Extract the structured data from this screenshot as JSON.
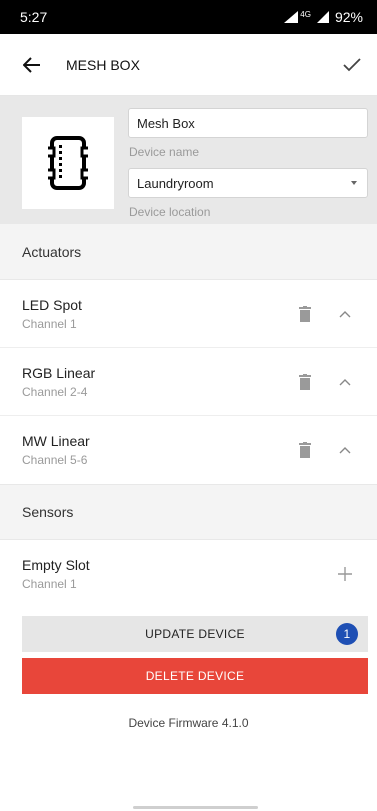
{
  "status_bar": {
    "time": "5:27",
    "network": "4G",
    "battery": "92%"
  },
  "app_bar": {
    "title": "MESH BOX"
  },
  "device": {
    "name_value": "Mesh Box",
    "name_label": "Device name",
    "location_value": "Laundryroom",
    "location_label": "Device location"
  },
  "actuators": {
    "header": "Actuators",
    "items": [
      {
        "name": "LED Spot",
        "channel": "Channel 1"
      },
      {
        "name": "RGB Linear",
        "channel": "Channel 2-4"
      },
      {
        "name": "MW Linear",
        "channel": "Channel 5-6"
      }
    ]
  },
  "sensors": {
    "header": "Sensors",
    "items": [
      {
        "name": "Empty Slot",
        "channel": "Channel 1"
      }
    ]
  },
  "actions": {
    "update_label": "UPDATE DEVICE",
    "update_badge": "1",
    "delete_label": "DELETE DEVICE"
  },
  "firmware": "Device Firmware 4.1.0",
  "colors": {
    "delete": "#e8463a",
    "badge": "#1e4fb4",
    "panel": "#e8e8e8"
  }
}
